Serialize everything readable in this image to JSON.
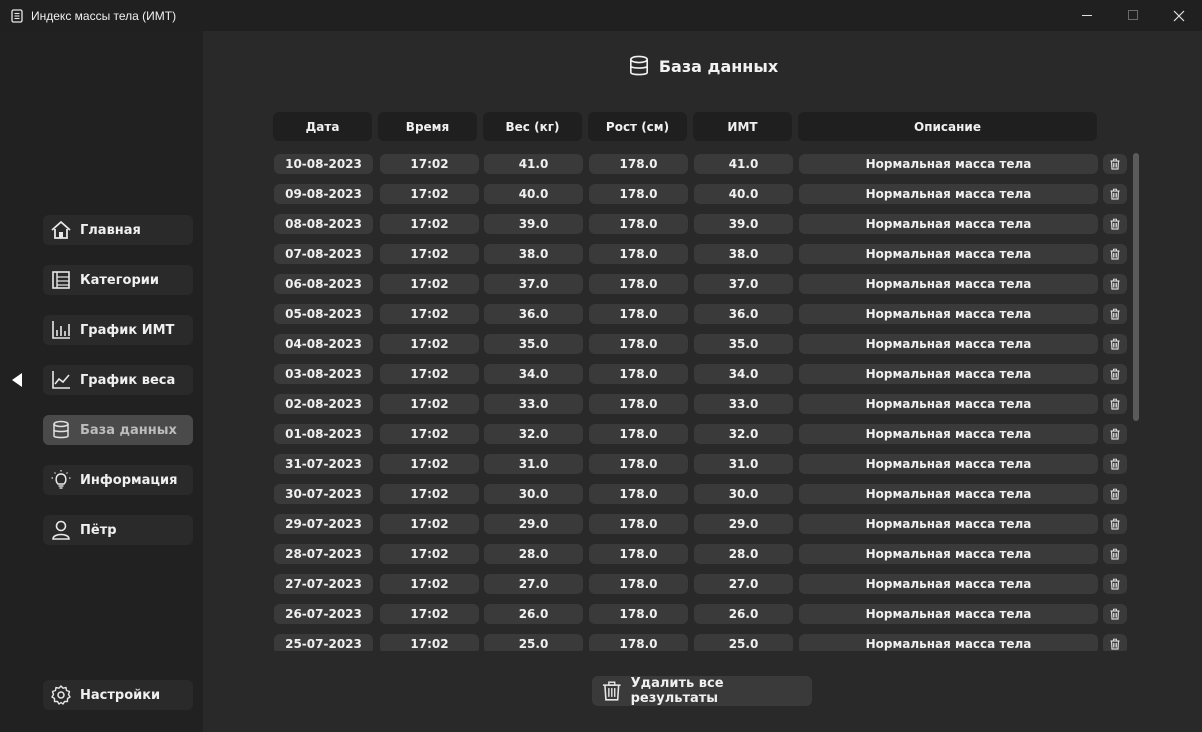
{
  "window": {
    "title": "Индекс массы тела (ИМТ)"
  },
  "sidebar": {
    "items": [
      {
        "label": "Главная",
        "icon": "home-icon"
      },
      {
        "label": "Категории",
        "icon": "categories-icon"
      },
      {
        "label": "График ИМТ",
        "icon": "bar-chart-icon"
      },
      {
        "label": "График веса",
        "icon": "line-chart-icon"
      },
      {
        "label": "База данных",
        "icon": "database-icon",
        "active": true
      },
      {
        "label": "Информация",
        "icon": "lightbulb-icon"
      },
      {
        "label": "Пётр",
        "icon": "user-icon"
      }
    ],
    "settings_label": "Настройки"
  },
  "main": {
    "title": "База данных",
    "columns": [
      "Дата",
      "Время",
      "Вес (кг)",
      "Рост (см)",
      "ИМТ",
      "Описание"
    ],
    "rows": [
      [
        "10-08-2023",
        "17:02",
        "41.0",
        "178.0",
        "41.0",
        "Нормальная масса тела"
      ],
      [
        "09-08-2023",
        "17:02",
        "40.0",
        "178.0",
        "40.0",
        "Нормальная масса тела"
      ],
      [
        "08-08-2023",
        "17:02",
        "39.0",
        "178.0",
        "39.0",
        "Нормальная масса тела"
      ],
      [
        "07-08-2023",
        "17:02",
        "38.0",
        "178.0",
        "38.0",
        "Нормальная масса тела"
      ],
      [
        "06-08-2023",
        "17:02",
        "37.0",
        "178.0",
        "37.0",
        "Нормальная масса тела"
      ],
      [
        "05-08-2023",
        "17:02",
        "36.0",
        "178.0",
        "36.0",
        "Нормальная масса тела"
      ],
      [
        "04-08-2023",
        "17:02",
        "35.0",
        "178.0",
        "35.0",
        "Нормальная масса тела"
      ],
      [
        "03-08-2023",
        "17:02",
        "34.0",
        "178.0",
        "34.0",
        "Нормальная масса тела"
      ],
      [
        "02-08-2023",
        "17:02",
        "33.0",
        "178.0",
        "33.0",
        "Нормальная масса тела"
      ],
      [
        "01-08-2023",
        "17:02",
        "32.0",
        "178.0",
        "32.0",
        "Нормальная масса тела"
      ],
      [
        "31-07-2023",
        "17:02",
        "31.0",
        "178.0",
        "31.0",
        "Нормальная масса тела"
      ],
      [
        "30-07-2023",
        "17:02",
        "30.0",
        "178.0",
        "30.0",
        "Нормальная масса тела"
      ],
      [
        "29-07-2023",
        "17:02",
        "29.0",
        "178.0",
        "29.0",
        "Нормальная масса тела"
      ],
      [
        "28-07-2023",
        "17:02",
        "28.0",
        "178.0",
        "28.0",
        "Нормальная масса тела"
      ],
      [
        "27-07-2023",
        "17:02",
        "27.0",
        "178.0",
        "27.0",
        "Нормальная масса тела"
      ],
      [
        "26-07-2023",
        "17:02",
        "26.0",
        "178.0",
        "26.0",
        "Нормальная масса тела"
      ],
      [
        "25-07-2023",
        "17:02",
        "25.0",
        "178.0",
        "25.0",
        "Нормальная масса тела"
      ]
    ],
    "delete_all_label": "Удалить все результаты"
  },
  "colors": {
    "window_bg": "#1f1f1f",
    "sidebar_bg": "#212121",
    "main_bg": "#292929",
    "cell_bg": "#3a3a3a",
    "header_bg": "#1f1f1f",
    "active_nav_bg": "#4a4a4a",
    "text": "#f0f0f0"
  }
}
